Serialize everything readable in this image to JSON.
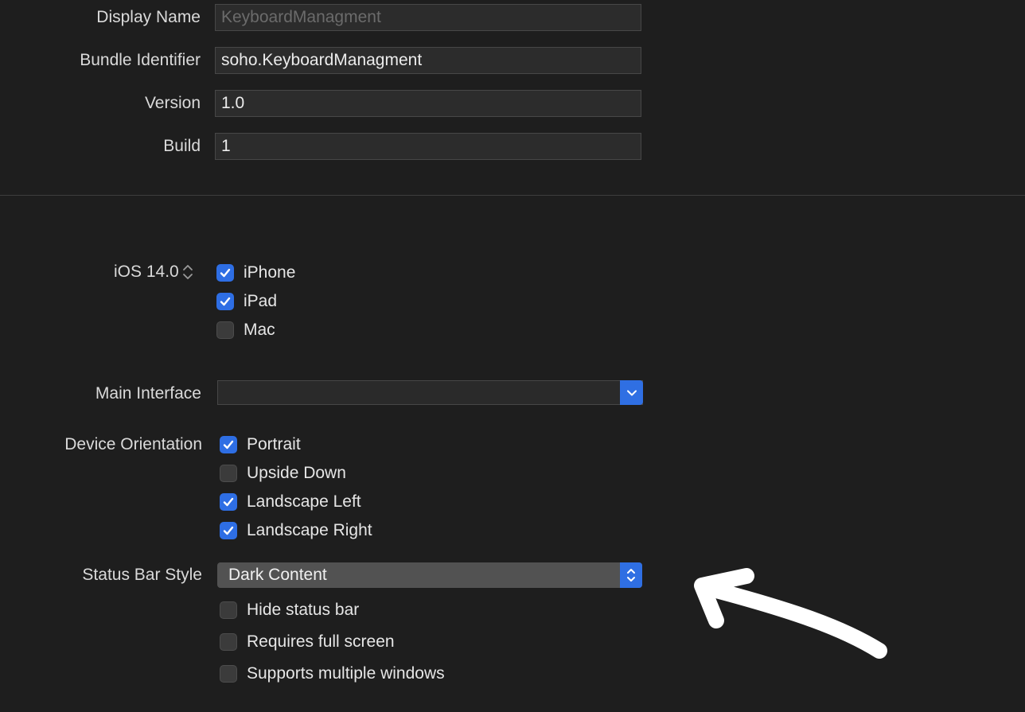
{
  "identity": {
    "display_name": {
      "label": "Display Name",
      "value": "",
      "placeholder": "KeyboardManagment"
    },
    "bundle_identifier": {
      "label": "Bundle Identifier",
      "value": "soho.KeyboardManagment"
    },
    "version": {
      "label": "Version",
      "value": "1.0"
    },
    "build": {
      "label": "Build",
      "value": "1"
    }
  },
  "deployment": {
    "ios_version": "iOS 14.0",
    "devices": [
      {
        "label": "iPhone",
        "checked": true
      },
      {
        "label": "iPad",
        "checked": true
      },
      {
        "label": "Mac",
        "checked": false
      }
    ],
    "main_interface": {
      "label": "Main Interface",
      "value": ""
    },
    "device_orientation": {
      "label": "Device Orientation",
      "options": [
        {
          "label": "Portrait",
          "checked": true
        },
        {
          "label": "Upside Down",
          "checked": false
        },
        {
          "label": "Landscape Left",
          "checked": true
        },
        {
          "label": "Landscape Right",
          "checked": true
        }
      ]
    },
    "status_bar_style": {
      "label": "Status Bar Style",
      "value": "Dark Content"
    },
    "status_options": [
      {
        "label": "Hide status bar",
        "checked": false
      },
      {
        "label": "Requires full screen",
        "checked": false
      },
      {
        "label": "Supports multiple windows",
        "checked": false
      }
    ]
  },
  "colors": {
    "background": "#1e1e1e",
    "accent": "#2f6fe3",
    "annotation_arrow": "#ffffff"
  },
  "icons": {
    "checkmark": "checkmark-icon",
    "stepper": "up-down-chevron-icon",
    "dropdown": "chevron-down-icon",
    "annotation": "hand-drawn-arrow"
  }
}
